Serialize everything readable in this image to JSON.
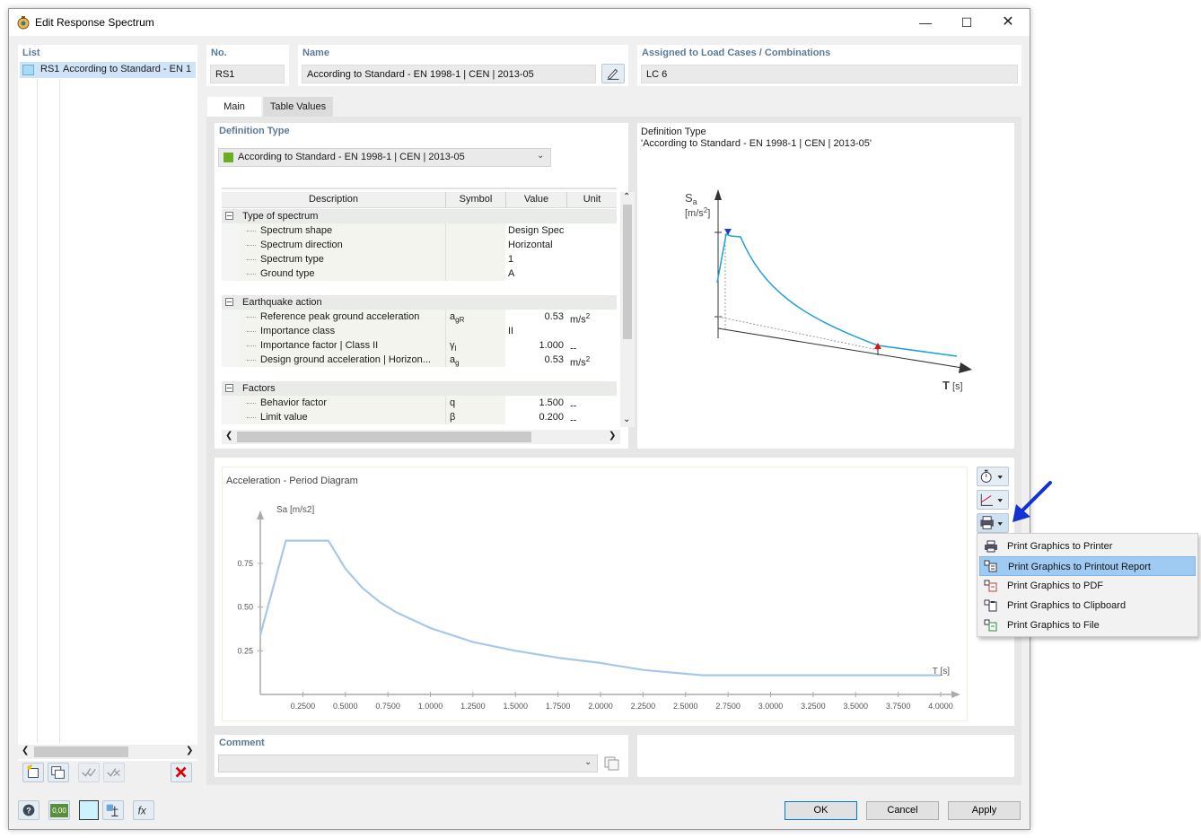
{
  "window": {
    "title": "Edit Response Spectrum"
  },
  "list": {
    "header": "List",
    "items": [
      {
        "id": "RS1",
        "label": "According to Standard - EN 1"
      }
    ]
  },
  "header_fields": {
    "no_label": "No.",
    "no_value": "RS1",
    "name_label": "Name",
    "name_value": "According to Standard - EN 1998-1 | CEN | 2013-05",
    "assigned_label": "Assigned to Load Cases / Combinations",
    "assigned_value": "LC 6"
  },
  "tabs": [
    {
      "label": "Main",
      "active": true
    },
    {
      "label": "Table Values",
      "active": false
    }
  ],
  "definition": {
    "label": "Definition Type",
    "selected": "According to Standard - EN 1998-1 | CEN | 2013-05",
    "swatch_color": "#6aae23"
  },
  "grid": {
    "columns": [
      "Description",
      "Symbol",
      "Value",
      "Unit"
    ],
    "groups": [
      {
        "title": "Type of spectrum",
        "rows": [
          {
            "desc": "Spectrum shape",
            "sym": "",
            "sym_sub": "",
            "val": "Design Spectrum",
            "unit": ""
          },
          {
            "desc": "Spectrum direction",
            "sym": "",
            "sym_sub": "",
            "val": "Horizontal",
            "unit": ""
          },
          {
            "desc": "Spectrum type",
            "sym": "",
            "sym_sub": "",
            "val": "1",
            "unit": ""
          },
          {
            "desc": "Ground type",
            "sym": "",
            "sym_sub": "",
            "val": "A",
            "unit": ""
          }
        ]
      },
      {
        "title": "Earthquake action",
        "rows": [
          {
            "desc": "Reference peak ground acceleration",
            "sym": "a",
            "sym_sub": "gR",
            "val": "0.53",
            "unit": "m/s",
            "unit_sup": "2"
          },
          {
            "desc": "Importance class",
            "sym": "",
            "sym_sub": "",
            "val": "II",
            "unit": ""
          },
          {
            "desc": "Importance factor | Class II",
            "sym": "γ",
            "sym_sub": "I",
            "val": "1.000",
            "unit": "--"
          },
          {
            "desc": "Design ground acceleration | Horizon...",
            "sym": "a",
            "sym_sub": "g",
            "val": "0.53",
            "unit": "m/s",
            "unit_sup": "2"
          }
        ]
      },
      {
        "title": "Factors",
        "rows": [
          {
            "desc": "Behavior factor",
            "sym": "q",
            "sym_sub": "",
            "val": "1.500",
            "unit": "--"
          },
          {
            "desc": "Limit value",
            "sym": "β",
            "sym_sub": "",
            "val": "0.200",
            "unit": "--"
          }
        ]
      }
    ]
  },
  "preview": {
    "title_line1": "Definition Type",
    "title_line2": "'According to Standard - EN 1998-1 | CEN | 2013-05'",
    "y_label": "S",
    "y_label_sub": "a",
    "y_unit": "[m/s",
    "y_unit_sup": "2",
    "y_unit_close": "]",
    "x_label": "T",
    "x_unit": "[s]"
  },
  "chart_data": {
    "type": "line",
    "title": "Acceleration - Period Diagram",
    "ylabel": "Sa [m/s2]",
    "xlabel": "T [s]",
    "xlim": [
      0,
      4.0
    ],
    "ylim": [
      0,
      0.95
    ],
    "x_ticks": [
      "0.2500",
      "0.5000",
      "0.7500",
      "1.0000",
      "1.2500",
      "1.5000",
      "1.7500",
      "2.0000",
      "2.2500",
      "2.5000",
      "2.7500",
      "3.0000",
      "3.2500",
      "3.5000",
      "3.7500",
      "4.0000"
    ],
    "y_ticks": [
      "0.25",
      "0.50",
      "0.75"
    ],
    "y_tick_values": [
      0.25,
      0.5,
      0.75
    ],
    "color": "#a6c8e8",
    "series": [
      {
        "x": [
          0.0,
          0.15,
          0.4,
          0.45,
          0.5,
          0.6,
          0.7,
          0.8,
          1.0,
          1.25,
          1.5,
          1.75,
          2.0,
          2.25,
          2.6,
          3.0,
          3.5,
          4.0
        ],
        "y": [
          0.34,
          0.88,
          0.88,
          0.8,
          0.72,
          0.61,
          0.53,
          0.47,
          0.38,
          0.3,
          0.25,
          0.21,
          0.18,
          0.14,
          0.11,
          0.11,
          0.11,
          0.11
        ]
      }
    ]
  },
  "comment": {
    "label": "Comment",
    "value": ""
  },
  "print_menu": {
    "items": [
      {
        "label": "Print Graphics to Printer",
        "selected": false
      },
      {
        "label": "Print Graphics to Printout Report",
        "selected": true
      },
      {
        "label": "Print Graphics to PDF",
        "selected": false
      },
      {
        "label": "Print Graphics to Clipboard",
        "selected": false
      },
      {
        "label": "Print Graphics to File",
        "selected": false
      }
    ]
  },
  "footer": {
    "ok": "OK",
    "cancel": "Cancel",
    "apply": "Apply",
    "units_badge": "0,00"
  },
  "colors": {
    "accent": "#5b7a99",
    "arrow": "#1432d2",
    "curve_preview": "#1ea0d8",
    "selection": "#9fcbf3"
  }
}
